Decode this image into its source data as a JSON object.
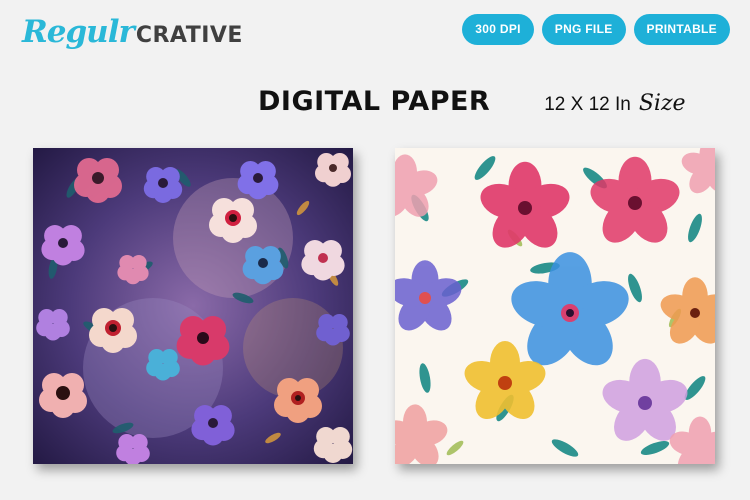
{
  "brand": {
    "script": "Regulr",
    "bold": "CRATIVE"
  },
  "badges": [
    "300 DPI",
    "PNG FILE",
    "PRINTABLE"
  ],
  "heading": {
    "title": "DIGITAL PAPER",
    "size_value": "12 X 12 In",
    "size_word": "Size"
  },
  "colors": {
    "accent": "#1eb0d8",
    "logo": "#2ab8d8",
    "background": "#f2f2f2"
  },
  "previews": [
    {
      "theme": "dark watercolor floral pattern"
    },
    {
      "theme": "light watercolor floral pattern"
    }
  ]
}
